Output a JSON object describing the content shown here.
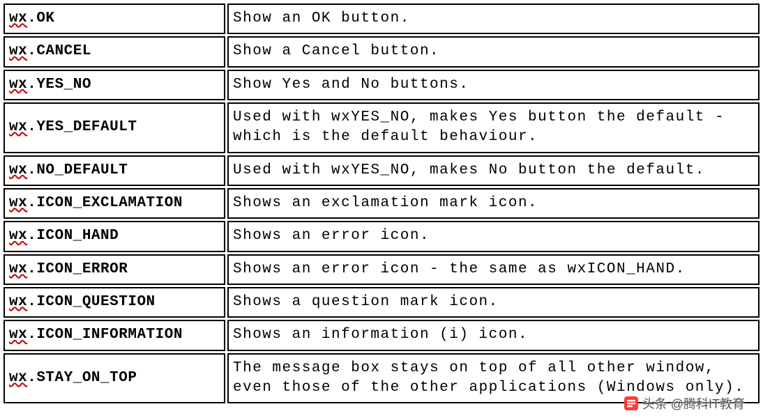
{
  "rows": [
    {
      "prefix": "wx",
      "constant": ".OK",
      "description": "Show an OK button."
    },
    {
      "prefix": "wx",
      "constant": ".CANCEL",
      "description": "Show a Cancel button."
    },
    {
      "prefix": "wx",
      "constant": ".YES_NO",
      "description": "Show Yes and No buttons."
    },
    {
      "prefix": "wx",
      "constant": ".YES_DEFAULT",
      "description": "Used with wxYES_NO, makes Yes button the default - which is the default behaviour."
    },
    {
      "prefix": "wx",
      "constant": ".NO_DEFAULT",
      "description": "Used with wxYES_NO, makes No button the default."
    },
    {
      "prefix": "wx",
      "constant": ".ICON_EXCLAMATION",
      "description": "Shows an exclamation mark icon."
    },
    {
      "prefix": "wx",
      "constant": ".ICON_HAND",
      "description": "Shows an error icon."
    },
    {
      "prefix": "wx",
      "constant": ".ICON_ERROR",
      "description": "Shows an error icon - the same as wxICON_HAND."
    },
    {
      "prefix": "wx",
      "constant": ".ICON_QUESTION",
      "description": "Shows a question mark icon."
    },
    {
      "prefix": "wx",
      "constant": ".ICON_INFORMATION",
      "description": "Shows an information (i) icon."
    },
    {
      "prefix": "wx",
      "constant": ".STAY_ON_TOP",
      "description": "The message box stays on top of all other window, even those of the other applications (Windows only)."
    }
  ],
  "watermark": "头条 @腾科IT教育"
}
